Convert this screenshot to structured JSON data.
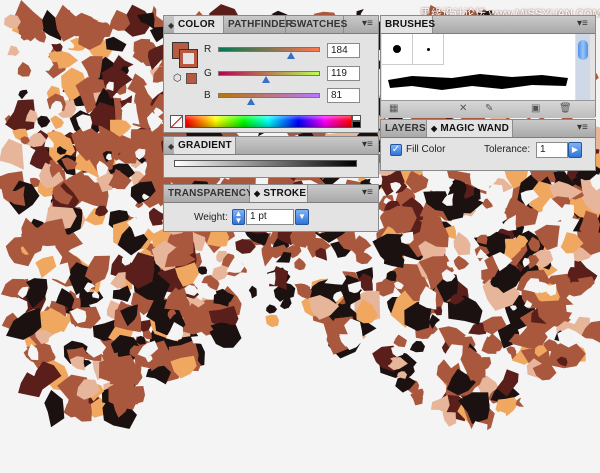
{
  "watermark": {
    "text": "思缘设计论坛 www.MISSYUAN.COM",
    "color": "#ffffff"
  },
  "color_panel": {
    "tabs": [
      {
        "label": "COLOR",
        "active": true
      },
      {
        "label": "PATHFINDER",
        "active": false
      },
      {
        "label": "SWATCHES",
        "active": false
      }
    ],
    "fill_color": "#b85a3f",
    "stroke_color": "#b85a3f",
    "channels": [
      {
        "label": "R",
        "value": "184",
        "fraction": 0.72
      },
      {
        "label": "G",
        "value": "119",
        "fraction": 0.47
      },
      {
        "label": "B",
        "value": "81",
        "fraction": 0.32
      }
    ]
  },
  "brushes_panel": {
    "tabs": [
      {
        "label": "BRUSHES",
        "active": true
      }
    ],
    "icons": [
      "brush-libraries-icon",
      "remove-stroke-icon",
      "brush-options-icon",
      "new-brush-icon",
      "delete-brush-icon"
    ]
  },
  "gradient_panel": {
    "tabs": [
      {
        "label": "GRADIENT",
        "active": true
      }
    ]
  },
  "stroke_panel": {
    "tabs": [
      {
        "label": "TRANSPARENCY",
        "active": false
      },
      {
        "label": "STROKE",
        "active": true
      }
    ],
    "weight_label": "Weight:",
    "weight_value": "1 pt"
  },
  "magic_wand_panel": {
    "tabs": [
      {
        "label": "LAYERS",
        "active": false
      },
      {
        "label": "MAGIC WAND",
        "active": true
      }
    ],
    "fill_color_label": "Fill Color",
    "fill_color_checked": true,
    "tolerance_label": "Tolerance:",
    "tolerance_value": "1"
  },
  "palette": {
    "brown": "#a9583d",
    "dark": "#1b1110",
    "maroon": "#5a1f1a",
    "light": "#e7b59a",
    "tan": "#f0a860"
  }
}
